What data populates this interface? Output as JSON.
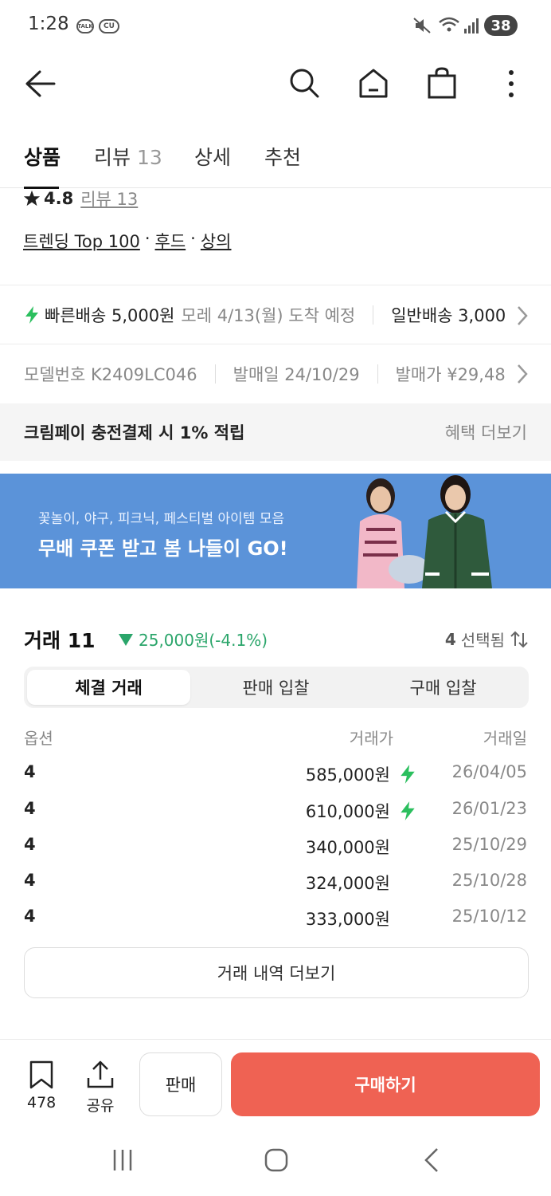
{
  "status_bar": {
    "time": "1:28",
    "app_badges": [
      "TALK",
      "CU"
    ],
    "battery": "38"
  },
  "header": {
    "icons": [
      "back-arrow-icon",
      "search-icon",
      "home-icon",
      "shopping-bag-icon",
      "more-vertical-icon"
    ]
  },
  "tabs": [
    {
      "label": "상품",
      "count": ""
    },
    {
      "label": "리뷰",
      "count": "13"
    },
    {
      "label": "상세",
      "count": ""
    },
    {
      "label": "추천",
      "count": ""
    }
  ],
  "rating": {
    "score": "4.8",
    "review_link": "리뷰 13"
  },
  "categories": {
    "trending": "트렌딩 Top 100",
    "sep": "·",
    "cat1": "후드",
    "cat2": "상의"
  },
  "shipping": {
    "fast_label": "빠른배송 5,000원",
    "fast_eta": "모레 4/13(월) 도착 예정",
    "normal_label": "일반배송 3,000"
  },
  "product_info": {
    "model": "모델번호 K2409LC046",
    "release": "발매일 24/10/29",
    "price": "발매가 ¥29,48"
  },
  "benefit": {
    "text": "크림페이 충전결제 시 1% 적립",
    "more": "혜택 더보기"
  },
  "banner": {
    "subtitle": "꽃놀이, 야구, 피크닉, 페스티벌 아이템 모음",
    "title": "무배 쿠폰 받고 봄 나들이 GO!"
  },
  "trades": {
    "title": "거래 11",
    "change": "25,000원(-4.1%)",
    "selected_count": "4",
    "selected_label": "선택됨",
    "segments": [
      "체결 거래",
      "판매 입찰",
      "구매 입찰"
    ],
    "columns": {
      "option": "옵션",
      "price": "거래가",
      "date": "거래일"
    },
    "rows": [
      {
        "option": "4",
        "price": "585,000원",
        "fast": true,
        "date": "26/04/05"
      },
      {
        "option": "4",
        "price": "610,000원",
        "fast": true,
        "date": "26/01/23"
      },
      {
        "option": "4",
        "price": "340,000원",
        "fast": false,
        "date": "25/10/29"
      },
      {
        "option": "4",
        "price": "324,000원",
        "fast": false,
        "date": "25/10/28"
      },
      {
        "option": "4",
        "price": "333,000원",
        "fast": false,
        "date": "25/10/12"
      }
    ],
    "more_button": "거래 내역 더보기"
  },
  "bottom_bar": {
    "bookmark_count": "478",
    "share_label": "공유",
    "sell_label": "판매",
    "buy_label": "구매하기"
  },
  "colors": {
    "accent_red": "#ef6253",
    "price_down_green": "#2aa56a",
    "fast_bolt_green": "#2bbf5e",
    "banner_blue": "#5b93d9"
  }
}
